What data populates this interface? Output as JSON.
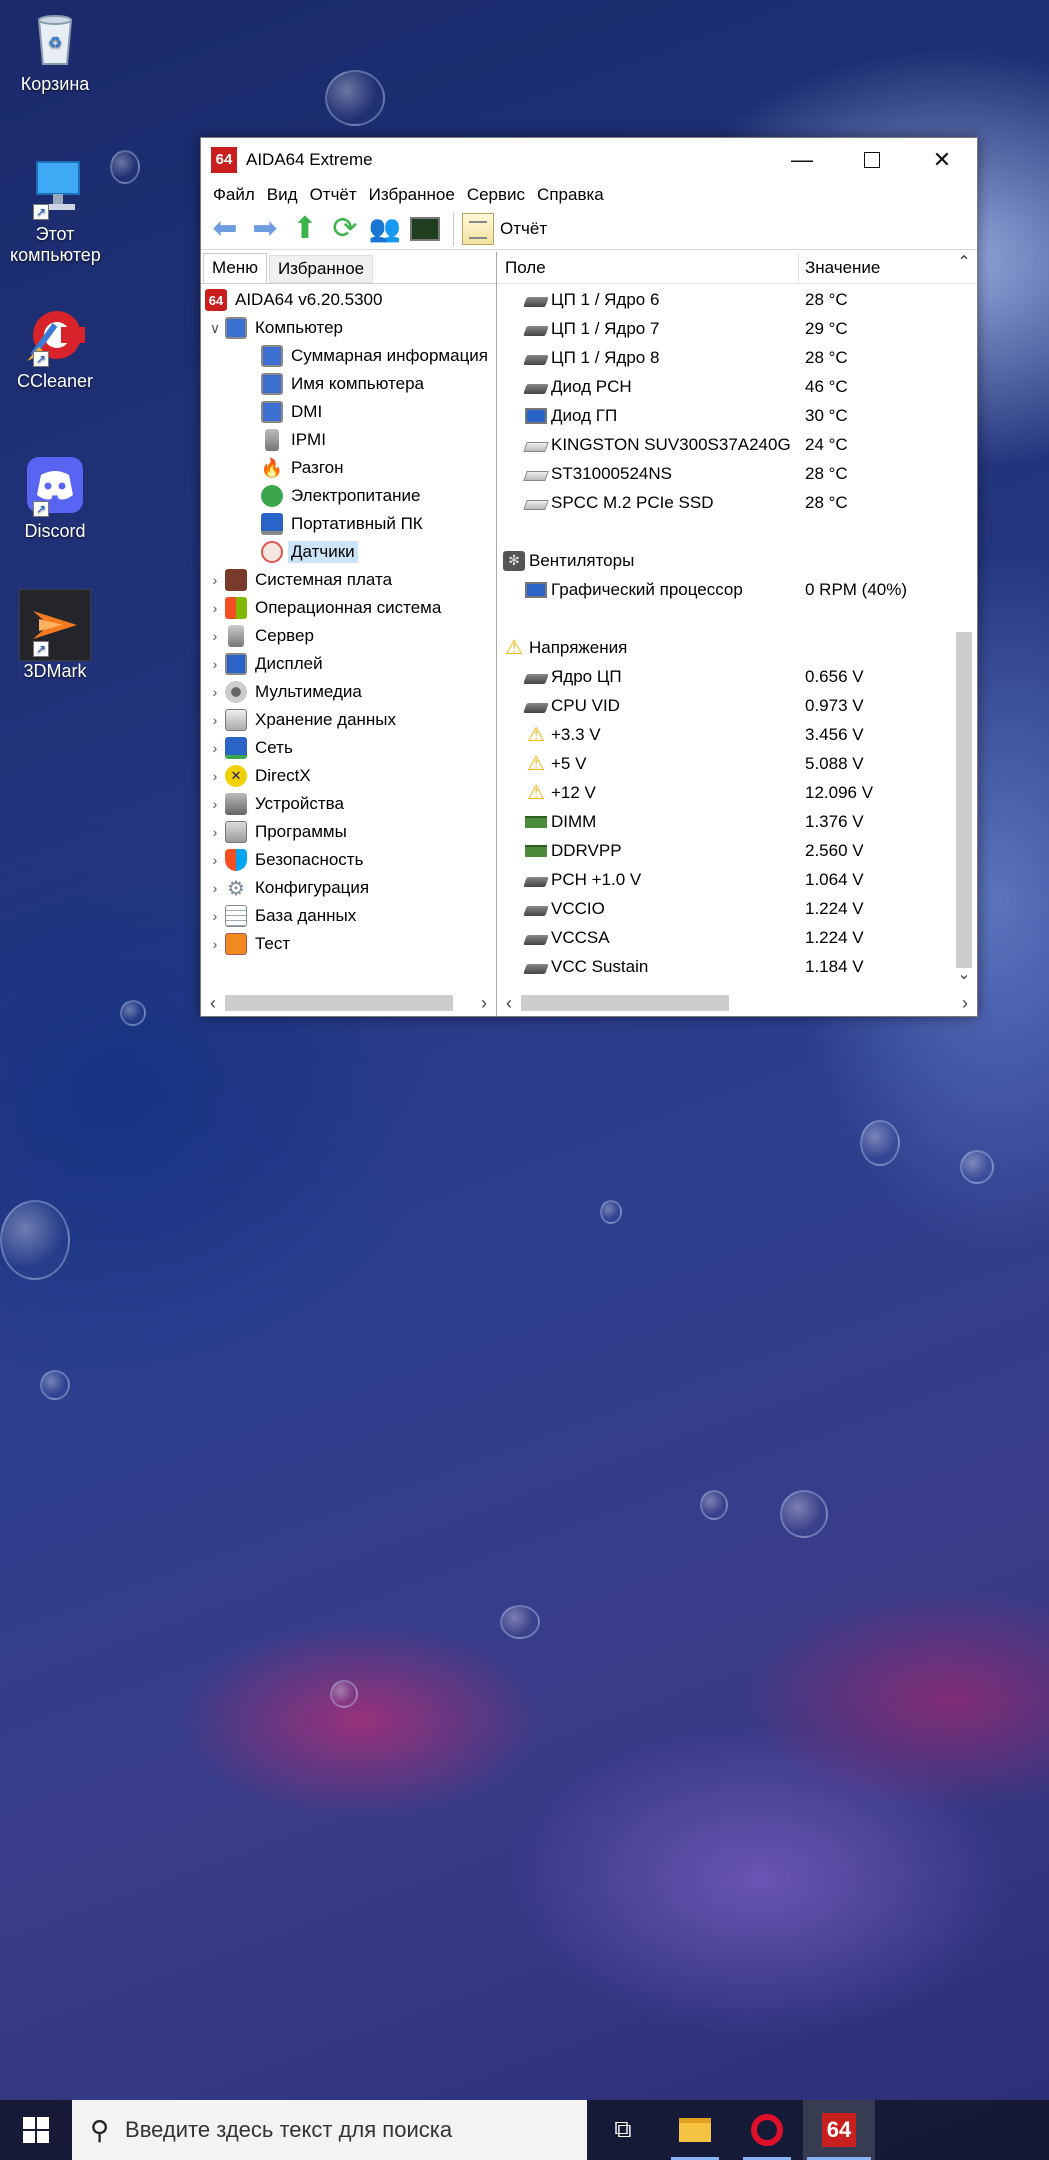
{
  "desktop": {
    "icons": [
      {
        "label": "Корзина",
        "icon": "recycle-bin-icon"
      },
      {
        "label": "Этот компьютер",
        "icon": "this-pc-icon"
      },
      {
        "label": "CCleaner",
        "icon": "ccleaner-icon"
      },
      {
        "label": "Discord",
        "icon": "discord-icon"
      },
      {
        "label": "3DMark",
        "icon": "3dmark-icon"
      }
    ]
  },
  "window": {
    "logo": "64",
    "title": "AIDA64 Extreme",
    "menu": [
      "Файл",
      "Вид",
      "Отчёт",
      "Избранное",
      "Сервис",
      "Справка"
    ],
    "toolbar": {
      "report_label": "Отчёт"
    },
    "tabs": [
      "Меню",
      "Избранное"
    ],
    "tree": {
      "root": "AIDA64 v6.20.5300",
      "computer": "Компьютер",
      "computer_children": [
        "Суммарная информация",
        "Имя компьютера",
        "DMI",
        "IPMI",
        "Разгон",
        "Электропитание",
        "Портативный ПК",
        "Датчики"
      ],
      "sections": [
        "Системная плата",
        "Операционная система",
        "Сервер",
        "Дисплей",
        "Мультимедиа",
        "Хранение данных",
        "Сеть",
        "DirectX",
        "Устройства",
        "Программы",
        "Безопасность",
        "Конфигурация",
        "База данных",
        "Тест"
      ]
    },
    "grid": {
      "col_field": "Поле",
      "col_value": "Значение",
      "rows": [
        {
          "f": "ЦП 1 / Ядро 6",
          "v": "28 °C",
          "icon": "chip"
        },
        {
          "f": "ЦП 1 / Ядро 7",
          "v": "29 °C",
          "icon": "chip"
        },
        {
          "f": "ЦП 1 / Ядро 8",
          "v": "28 °C",
          "icon": "chip"
        },
        {
          "f": "Диод PCH",
          "v": "46 °C",
          "icon": "chip"
        },
        {
          "f": "Диод ГП",
          "v": "30 °C",
          "icon": "mon"
        },
        {
          "f": "KINGSTON SUV300S37A240G",
          "v": "24 °C",
          "icon": "disk"
        },
        {
          "f": "ST31000524NS",
          "v": "28 °C",
          "icon": "disk"
        },
        {
          "f": "SPCC M.2 PCIe SSD",
          "v": "28 °C",
          "icon": "disk"
        }
      ],
      "fans_group": "Вентиляторы",
      "fans_rows": [
        {
          "f": "Графический процессор",
          "v": "0 RPM  (40%)",
          "icon": "mon"
        }
      ],
      "volt_group": "Напряжения",
      "volt_rows": [
        {
          "f": "Ядро ЦП",
          "v": "0.656 V",
          "icon": "chip"
        },
        {
          "f": "CPU VID",
          "v": "0.973 V",
          "icon": "chip"
        },
        {
          "f": "+3.3 V",
          "v": "3.456 V",
          "icon": "warn"
        },
        {
          "f": "+5 V",
          "v": "5.088 V",
          "icon": "warn"
        },
        {
          "f": "+12 V",
          "v": "12.096 V",
          "icon": "warn"
        },
        {
          "f": "DIMM",
          "v": "1.376 V",
          "icon": "ram"
        },
        {
          "f": "DDRVPP",
          "v": "2.560 V",
          "icon": "ram"
        },
        {
          "f": "PCH +1.0 V",
          "v": "1.064 V",
          "icon": "chip"
        },
        {
          "f": "VCCIO",
          "v": "1.224 V",
          "icon": "chip"
        },
        {
          "f": "VCCSA",
          "v": "1.224 V",
          "icon": "chip"
        },
        {
          "f": "VCC Sustain",
          "v": "1.184 V",
          "icon": "chip"
        }
      ]
    }
  },
  "taskbar": {
    "search_placeholder": "Введите здесь текст для поиска",
    "aida_label": "64"
  }
}
